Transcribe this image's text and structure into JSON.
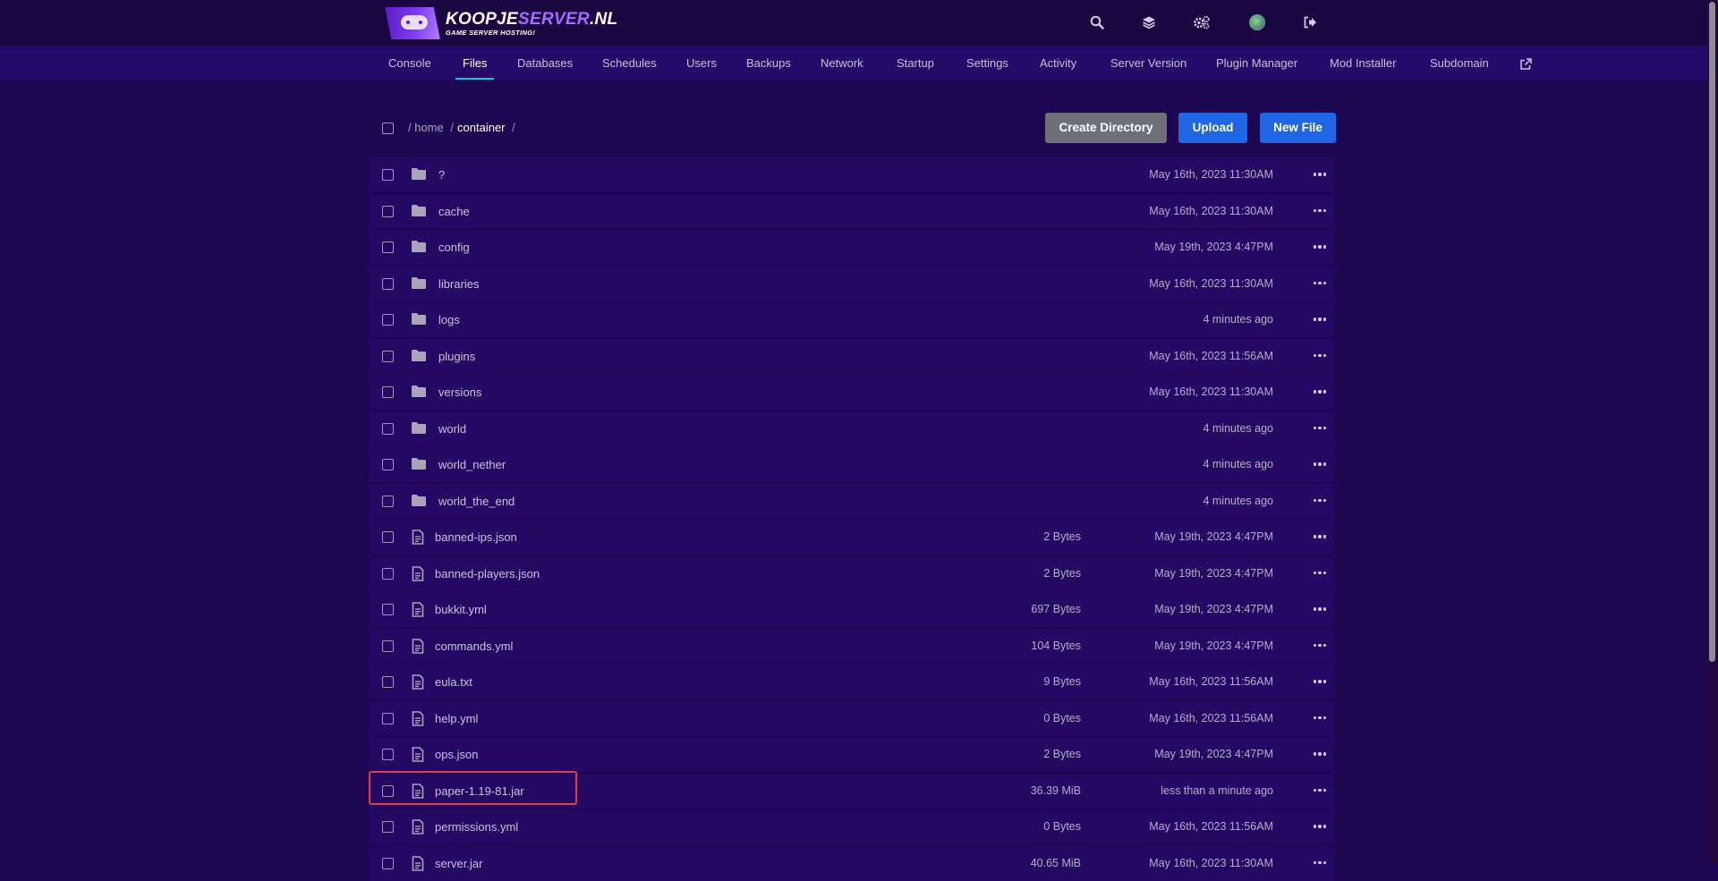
{
  "brand": {
    "name_part1": "KOOPJE",
    "name_part2": "SERVER",
    "name_part3": ".NL",
    "tagline": "GAME SERVER HOSTING!",
    "accent_color": "#a66bff"
  },
  "header_icons": [
    "search-icon",
    "layers-icon",
    "cogs-icon",
    "avatar",
    "sign-out-icon"
  ],
  "nav": {
    "tabs": [
      {
        "label": "Console"
      },
      {
        "label": "Files",
        "active": true
      },
      {
        "label": "Databases"
      },
      {
        "label": "Schedules"
      },
      {
        "label": "Users"
      },
      {
        "label": "Backups"
      },
      {
        "label": "Network"
      },
      {
        "label": "Startup"
      },
      {
        "label": "Settings"
      },
      {
        "label": "Activity"
      },
      {
        "label": "Server Version"
      },
      {
        "label": "Plugin Manager"
      },
      {
        "label": "Mod Installer"
      },
      {
        "label": "Subdomain"
      }
    ],
    "external_icon": "external-link-icon"
  },
  "breadcrumb": {
    "root": "/",
    "home": "home",
    "sep": "/",
    "current": "container"
  },
  "actions": {
    "create_directory": "Create Directory",
    "upload": "Upload",
    "new_file": "New File"
  },
  "files": [
    {
      "type": "folder",
      "name": "?",
      "size": "",
      "modified": "May 16th, 2023 11:30AM"
    },
    {
      "type": "folder",
      "name": "cache",
      "size": "",
      "modified": "May 16th, 2023 11:30AM"
    },
    {
      "type": "folder",
      "name": "config",
      "size": "",
      "modified": "May 19th, 2023 4:47PM"
    },
    {
      "type": "folder",
      "name": "libraries",
      "size": "",
      "modified": "May 16th, 2023 11:30AM"
    },
    {
      "type": "folder",
      "name": "logs",
      "size": "",
      "modified": "4 minutes ago"
    },
    {
      "type": "folder",
      "name": "plugins",
      "size": "",
      "modified": "May 16th, 2023 11:56AM"
    },
    {
      "type": "folder",
      "name": "versions",
      "size": "",
      "modified": "May 16th, 2023 11:30AM"
    },
    {
      "type": "folder",
      "name": "world",
      "size": "",
      "modified": "4 minutes ago"
    },
    {
      "type": "folder",
      "name": "world_nether",
      "size": "",
      "modified": "4 minutes ago"
    },
    {
      "type": "folder",
      "name": "world_the_end",
      "size": "",
      "modified": "4 minutes ago"
    },
    {
      "type": "file",
      "name": "banned-ips.json",
      "size": "2 Bytes",
      "modified": "May 19th, 2023 4:47PM"
    },
    {
      "type": "file",
      "name": "banned-players.json",
      "size": "2 Bytes",
      "modified": "May 19th, 2023 4:47PM"
    },
    {
      "type": "file",
      "name": "bukkit.yml",
      "size": "697 Bytes",
      "modified": "May 19th, 2023 4:47PM"
    },
    {
      "type": "file",
      "name": "commands.yml",
      "size": "104 Bytes",
      "modified": "May 19th, 2023 4:47PM"
    },
    {
      "type": "file",
      "name": "eula.txt",
      "size": "9 Bytes",
      "modified": "May 16th, 2023 11:56AM"
    },
    {
      "type": "file",
      "name": "help.yml",
      "size": "0 Bytes",
      "modified": "May 16th, 2023 11:56AM"
    },
    {
      "type": "file",
      "name": "ops.json",
      "size": "2 Bytes",
      "modified": "May 19th, 2023 4:47PM"
    },
    {
      "type": "file",
      "name": "paper-1.19-81.jar",
      "size": "36.39 MiB",
      "modified": "less than a minute ago",
      "highlighted": true
    },
    {
      "type": "file",
      "name": "permissions.yml",
      "size": "0 Bytes",
      "modified": "May 16th, 2023 11:56AM"
    },
    {
      "type": "file",
      "name": "server.jar",
      "size": "40.65 MiB",
      "modified": "May 16th, 2023 11:30AM"
    }
  ],
  "colors": {
    "background": "#1e0752",
    "row": "#240864",
    "primary_button": "#1f66e5",
    "secondary_button": "#6d7076",
    "active_tab_underline": "#19c3c9",
    "highlight": "#e23c44"
  }
}
